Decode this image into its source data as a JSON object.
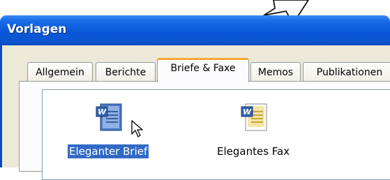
{
  "window": {
    "title": "Vorlagen"
  },
  "tabs": [
    {
      "label": "Allgemein"
    },
    {
      "label": "Berichte"
    },
    {
      "label": "Briefe & Faxe",
      "active": true
    },
    {
      "label": "Memos"
    },
    {
      "label": "Publikationen"
    }
  ],
  "templates": [
    {
      "label": "Eleganter Brief",
      "selected": true
    },
    {
      "label": "Elegantes Fax",
      "selected": false
    }
  ],
  "colors": {
    "titlebar": "#0a57d8",
    "active_tab_accent": "#f3a934",
    "selection": "#316ac5"
  }
}
